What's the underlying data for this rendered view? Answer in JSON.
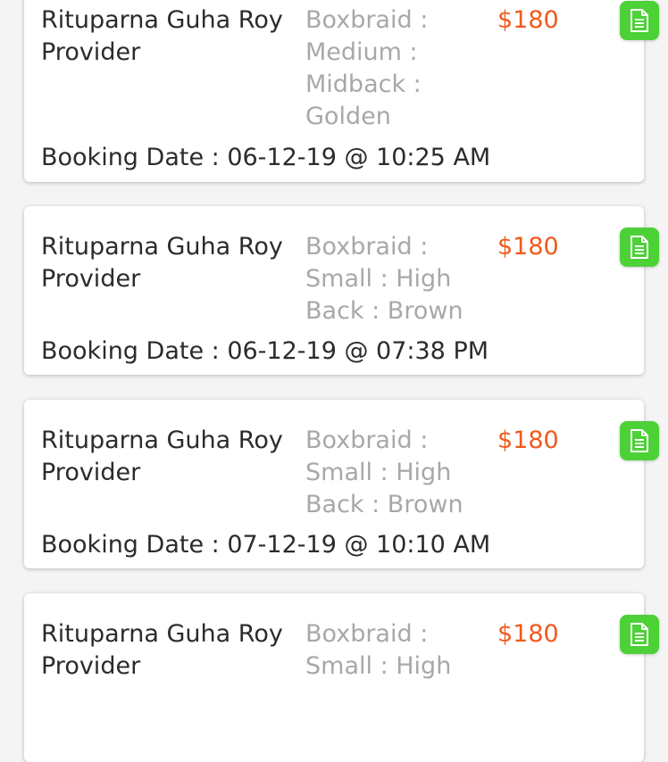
{
  "bookings": [
    {
      "provider_name": "Rituparna Guha Roy",
      "provider_role": "Provider",
      "service_lines": [
        "Boxbraid :",
        "Medium :",
        "Midback :",
        "Golden"
      ],
      "price": "$180",
      "booking_label": "Booking Date : 06-12-19 @ 10:25 AM",
      "icon": "document-icon"
    },
    {
      "provider_name": "Rituparna Guha Roy",
      "provider_role": "Provider",
      "service_lines": [
        "Boxbraid :",
        "Small : High",
        "Back : Brown"
      ],
      "price": "$180",
      "booking_label": "Booking Date : 06-12-19 @ 07:38 PM",
      "icon": "document-icon"
    },
    {
      "provider_name": "Rituparna Guha Roy",
      "provider_role": "Provider",
      "service_lines": [
        "Boxbraid :",
        "Small : High",
        "Back : Brown"
      ],
      "price": "$180",
      "booking_label": "Booking Date : 07-12-19 @ 10:10 AM",
      "icon": "document-icon"
    },
    {
      "provider_name": "Rituparna Guha Roy",
      "provider_role": "Provider",
      "service_lines": [
        "Boxbraid :",
        "Small : High"
      ],
      "price": "$180",
      "icon": "document-icon"
    }
  ],
  "colors": {
    "price": "#ef5a1c",
    "icon_button": "#4cd137",
    "service_text": "#a8a8a8",
    "primary_text": "#2b2b2b"
  }
}
